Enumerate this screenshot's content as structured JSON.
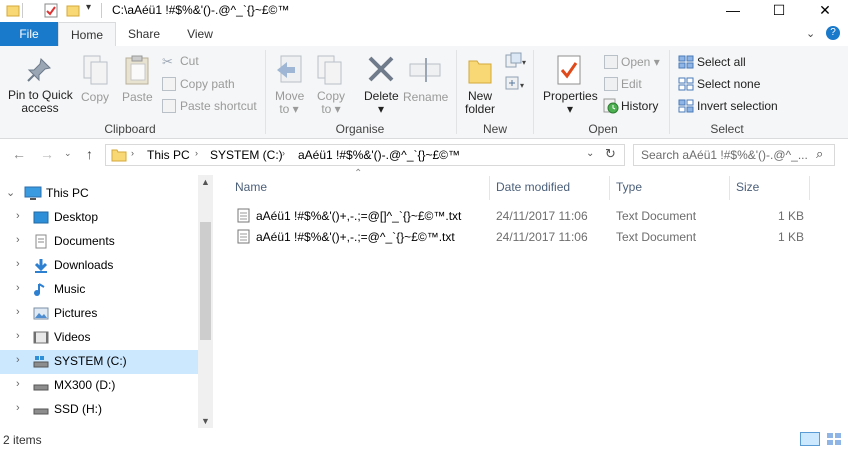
{
  "window": {
    "title": "C:\\aAéü1 !#$%&'()-.@^_`{}~£©™"
  },
  "tabs": {
    "file": "File",
    "home": "Home",
    "share": "Share",
    "view": "View"
  },
  "ribbon": {
    "clipboard": {
      "label": "Clipboard",
      "pin": "Pin to Quick access",
      "pin_l1": "Pin to Quick",
      "pin_l2": "access",
      "copy": "Copy",
      "paste": "Paste",
      "cut": "Cut",
      "copy_path": "Copy path",
      "paste_shortcut": "Paste shortcut"
    },
    "organise": {
      "label": "Organise",
      "move_to": "Move",
      "move_to_2": "to",
      "copy_to": "Copy",
      "copy_to_2": "to",
      "delete": "Delete",
      "rename": "Rename"
    },
    "new": {
      "label": "New",
      "new_folder": "New",
      "new_folder_2": "folder"
    },
    "open": {
      "label": "Open",
      "properties": "Properties",
      "open": "Open",
      "edit": "Edit",
      "history": "History"
    },
    "select": {
      "label": "Select",
      "select_all": "Select all",
      "select_none": "Select none",
      "invert": "Invert selection"
    }
  },
  "address": {
    "crumbs": [
      "This PC",
      "SYSTEM (C:)",
      "aAéü1 !#$%&'()-.@^_`{}~£©™"
    ],
    "search_placeholder": "Search aAéü1 !#$%&'()-.@^_..."
  },
  "nav": {
    "items": [
      {
        "label": "This PC",
        "icon": "computer-icon"
      },
      {
        "label": "Desktop",
        "icon": "desktop-icon"
      },
      {
        "label": "Documents",
        "icon": "documents-icon"
      },
      {
        "label": "Downloads",
        "icon": "downloads-icon"
      },
      {
        "label": "Music",
        "icon": "music-icon"
      },
      {
        "label": "Pictures",
        "icon": "pictures-icon"
      },
      {
        "label": "Videos",
        "icon": "videos-icon"
      },
      {
        "label": "SYSTEM (C:)",
        "icon": "system-drive-icon"
      },
      {
        "label": "MX300 (D:)",
        "icon": "drive-icon"
      },
      {
        "label": "SSD (H:)",
        "icon": "drive-icon"
      }
    ]
  },
  "files": {
    "columns": [
      "Name",
      "Date modified",
      "Type",
      "Size"
    ],
    "rows": [
      {
        "name": "aAéü1 !#$%&'()+,-.;=@[]^_`{}~£©™.txt",
        "date": "24/11/2017 11:06",
        "type": "Text Document",
        "size": "1 KB"
      },
      {
        "name": "aAéü1 !#$%&'()+,-.;=@^_`{}~£©™.txt",
        "date": "24/11/2017 11:06",
        "type": "Text Document",
        "size": "1 KB"
      }
    ]
  },
  "status": {
    "count": "2 items"
  },
  "colors": {
    "accent": "#1979ca",
    "selected": "#cce8ff",
    "folder": "#f8d775"
  }
}
